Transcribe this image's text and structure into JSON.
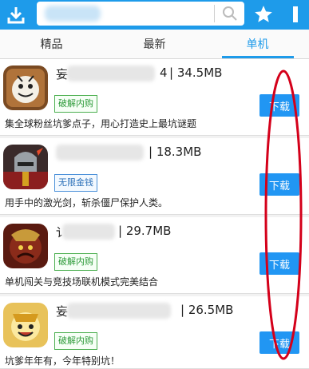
{
  "header": {
    "download_icon": "download-icon",
    "search_icon": "search-icon",
    "star_icon": "star-icon",
    "menu_icon": "more-icon"
  },
  "search": {
    "value": "",
    "placeholder": ""
  },
  "tabs": [
    {
      "label": "精品",
      "active": false
    },
    {
      "label": "最新",
      "active": false
    },
    {
      "label": "单机",
      "active": true
    }
  ],
  "apps": [
    {
      "name_prefix": "妄",
      "name_suffix": "4",
      "size": "| 34.5MB",
      "tag": "破解内购",
      "desc": "集全球粉丝坑爹点子，用心打造史上最坑谜题",
      "download": "下载",
      "icon": "cartoon-face-icon"
    },
    {
      "name_prefix": "",
      "name_suffix": "",
      "size": "| 18.3MB",
      "tag": "无限金钱",
      "desc": "用手中的激光剑，斩杀僵尸保护人类。",
      "download": "下载",
      "icon": "knight-icon"
    },
    {
      "name_prefix": "讠",
      "name_suffix": "",
      "size": "| 29.7MB",
      "tag": "破解内购",
      "desc": "单机闯关与竞技场联机模式完美结合",
      "download": "下载",
      "icon": "warrior-icon"
    },
    {
      "name_prefix": "妄",
      "name_suffix": "",
      "size": "| 26.5MB",
      "tag": "破解内购",
      "desc": "坑爹年年有，今年特别坑！",
      "download": "下载",
      "icon": "gold-smile-icon"
    }
  ],
  "colors": {
    "accent": "#1e9bea",
    "tag_green": "#4caf50",
    "annotation": "#d4001a"
  }
}
